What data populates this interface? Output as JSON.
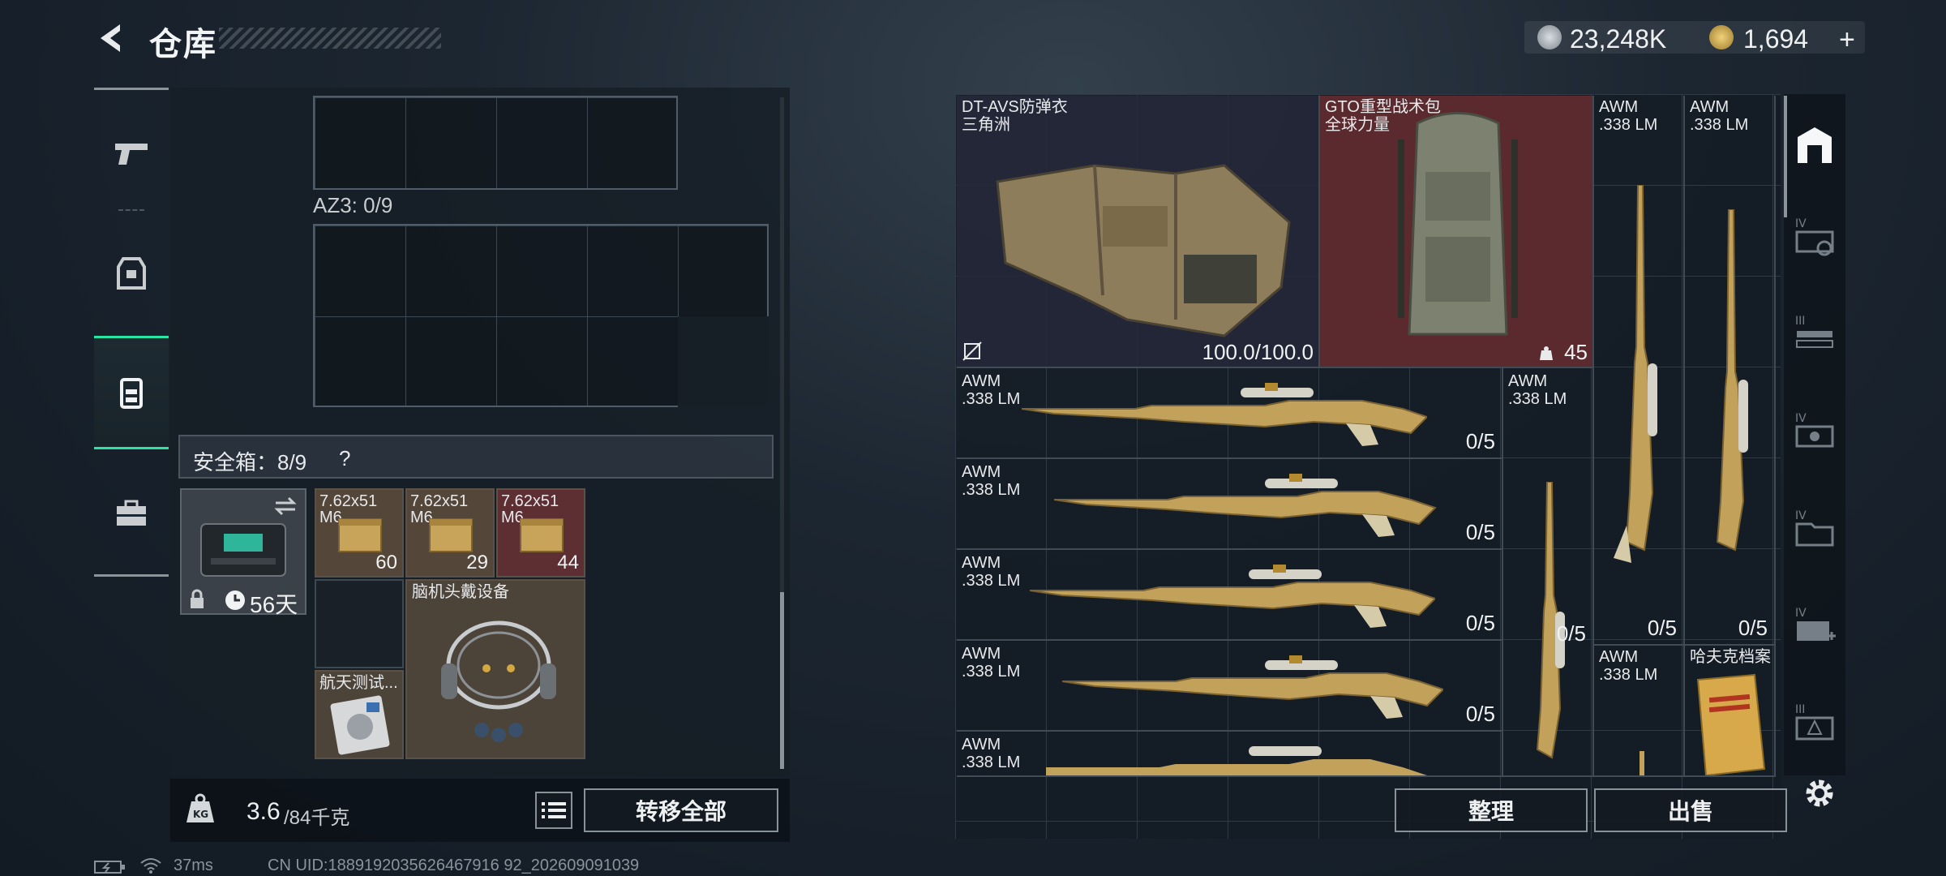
{
  "header": {
    "title": "仓库"
  },
  "currency": {
    "silver": "23,248K",
    "gold": "1,694",
    "plus": "+"
  },
  "left_nav": {
    "items": [
      "pistol",
      "armor",
      "backpack",
      "case"
    ],
    "active": "backpack"
  },
  "left_panel": {
    "az3_label": "AZ3: 0/9",
    "safe_box": {
      "label": "安全箱：8/9",
      "help": "?"
    },
    "safe_case": {
      "timer": "56天"
    },
    "ammo": [
      {
        "name": "7.62x51",
        "sub": "M6..",
        "qty": "60"
      },
      {
        "name": "7.62x51",
        "sub": "M6..",
        "qty": "29"
      },
      {
        "name": "7.62x51",
        "sub": "M6..",
        "qty": "44"
      }
    ],
    "items": [
      {
        "name": "脑机头戴设备"
      },
      {
        "name": "航天测试..."
      }
    ],
    "weight": {
      "value": "3.6",
      "max": "/84千克"
    },
    "transfer_all": "转移全部"
  },
  "right_panel": {
    "armor": {
      "name": "DT-AVS防弹衣",
      "brand": "三角洲",
      "durability": "100.0/100.0"
    },
    "backpack": {
      "name": "GTO重型战术包",
      "brand": "全球力量",
      "count": "45"
    },
    "rifles": [
      {
        "name": "AWM",
        "caliber": ".338 LM",
        "ammo": "0/5"
      },
      {
        "name": "AWM",
        "caliber": ".338 LM",
        "ammo": "0/5"
      },
      {
        "name": "AWM",
        "caliber": ".338 LM",
        "ammo": "0/5"
      },
      {
        "name": "AWM",
        "caliber": ".338 LM",
        "ammo": "0/5"
      },
      {
        "name": "AWM",
        "caliber": ".338 LM",
        "ammo": ""
      }
    ],
    "vertical_rifles": [
      {
        "name": "AWM",
        "caliber": ".338 LM",
        "ammo": "0/5"
      },
      {
        "name": "AWM",
        "caliber": ".338 LM",
        "ammo": "0/5"
      },
      {
        "name": "AWM",
        "caliber": ".338 LM",
        "ammo": "0/5"
      },
      {
        "name": "AWM",
        "caliber": ".338 LM",
        "ammo": ""
      }
    ],
    "document": {
      "name": "哈夫克档案"
    },
    "sort_button": "整理",
    "sell_button": "出售",
    "sidebar": {
      "levels": [
        "IV",
        "III",
        "IV",
        "IV",
        "IV",
        "III"
      ]
    }
  },
  "status_bar": {
    "ping": "37ms",
    "uid": "CN UID:1889192035626467916 92_202609091039"
  }
}
